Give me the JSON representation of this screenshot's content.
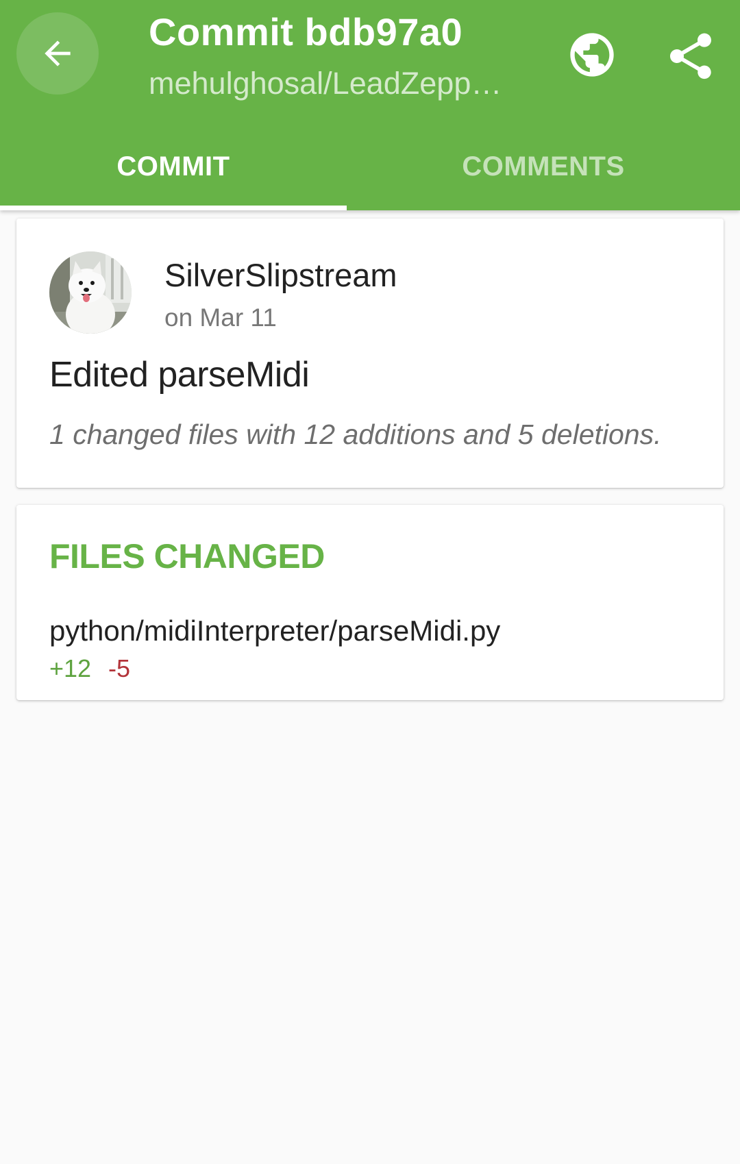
{
  "colors": {
    "primary": "#67b347",
    "additions": "#5ea33f",
    "deletions": "#b3343a",
    "background": "#fafafa"
  },
  "toolbar": {
    "title": "Commit bdb97a0",
    "subtitle": "mehulghosal/LeadZeppelin",
    "back_icon": "arrow-back-icon",
    "browser_icon": "globe-icon",
    "share_icon": "share-icon"
  },
  "tabs": [
    {
      "label": "COMMIT",
      "selected": true
    },
    {
      "label": "COMMENTS",
      "selected": false
    }
  ],
  "commit": {
    "author": "SilverSlipstream",
    "date": "on Mar 11",
    "message": "Edited parseMidi",
    "summary": "1 changed files with 12 additions and 5 deletions."
  },
  "files_changed": {
    "header": "FILES CHANGED",
    "files": [
      {
        "path": "python/midiInterpreter/parseMidi.py",
        "additions": "+12",
        "deletions": "-5"
      }
    ]
  }
}
